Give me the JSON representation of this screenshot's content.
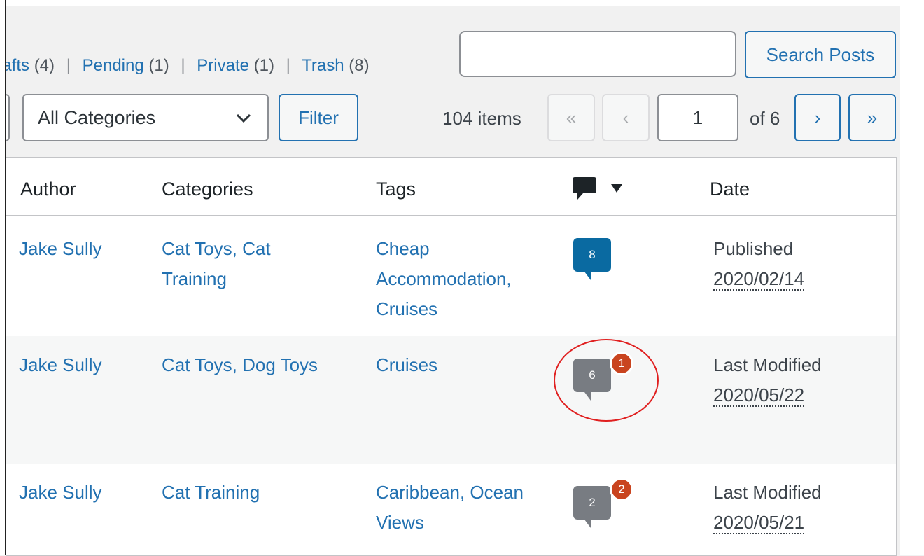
{
  "status_links": [
    {
      "label": "Drafts",
      "count": "(4)"
    },
    {
      "label": "Pending",
      "count": "(1)"
    },
    {
      "label": "Private",
      "count": "(1)"
    },
    {
      "label": "Trash",
      "count": "(8)"
    }
  ],
  "search": {
    "value": "",
    "button_label": "Search Posts"
  },
  "filters": {
    "category_selected": "All Categories",
    "filter_label": "Filter"
  },
  "pagination": {
    "items_count": "104 items",
    "first": "«",
    "prev": "‹",
    "current_page": "1",
    "of_label": "of 6",
    "next": "›",
    "last": "»"
  },
  "columns": {
    "author": "Author",
    "categories": "Categories",
    "tags": "Tags",
    "comments_icon": "comment-icon",
    "date": "Date"
  },
  "rows": [
    {
      "author": "Jake Sully",
      "categories": [
        "Cat Toys, Cat",
        "Training"
      ],
      "tags": [
        "Cheap",
        "Accommodation,",
        "Cruises"
      ],
      "comments": "8",
      "pending": "",
      "date_status": "Published",
      "date": "2020/02/14"
    },
    {
      "author": "Jake Sully",
      "categories": [
        "Cat Toys, Dog Toys"
      ],
      "tags": [
        "Cruises"
      ],
      "comments": "6",
      "pending": "1",
      "date_status": "Last Modified",
      "date": "2020/05/22"
    },
    {
      "author": "Jake Sully",
      "categories": [
        "Cat Training"
      ],
      "tags": [
        "Caribbean, Ocean",
        "Views"
      ],
      "comments": "2",
      "pending": "2",
      "date_status": "Last Modified",
      "date": "2020/05/21"
    }
  ],
  "colors": {
    "link": "#2271b1",
    "approved_bubble": "#0a6aa1",
    "pending_badge": "#c9441f",
    "highlight_circle": "#e02020"
  }
}
